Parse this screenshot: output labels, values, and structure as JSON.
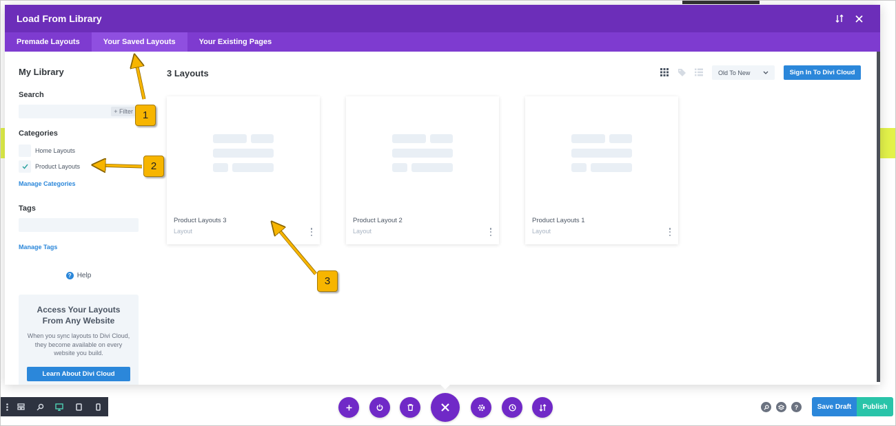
{
  "modal": {
    "title": "Load From Library",
    "tabs": [
      {
        "label": "Premade Layouts",
        "active": false
      },
      {
        "label": "Your Saved Layouts",
        "active": true
      },
      {
        "label": "Your Existing Pages",
        "active": false
      }
    ]
  },
  "sidebar": {
    "title": "My Library",
    "search_label": "Search",
    "filter_label": "+ Filter",
    "categories_label": "Categories",
    "categories": [
      {
        "label": "Home Layouts",
        "checked": false
      },
      {
        "label": "Product Layouts",
        "checked": true
      }
    ],
    "manage_categories": "Manage Categories",
    "tags_label": "Tags",
    "manage_tags": "Manage Tags",
    "help_label": "Help",
    "cloud": {
      "title": "Access Your Layouts From Any Website",
      "text": "When you sync layouts to Divi Cloud, they become available on every website you build.",
      "button": "Learn About Divi Cloud"
    }
  },
  "main": {
    "count_label": "3 Layouts",
    "sort_value": "Old To New",
    "signin_label": "Sign In To Divi Cloud",
    "cards": [
      {
        "name": "Product Layouts 3",
        "type": "Layout"
      },
      {
        "name": "Product Layout 2",
        "type": "Layout"
      },
      {
        "name": "Product Layouts 1",
        "type": "Layout"
      }
    ]
  },
  "annotations": {
    "badges": [
      "1",
      "2",
      "3"
    ]
  },
  "bottom_bar": {
    "save_draft": "Save Draft",
    "publish": "Publish"
  },
  "colors": {
    "header_purple": "#6c2eb9",
    "tab_purple": "#7e3bd0",
    "accent_blue": "#2b87da",
    "publish_green": "#29c4a9",
    "annotation_yellow": "#f7b500"
  }
}
